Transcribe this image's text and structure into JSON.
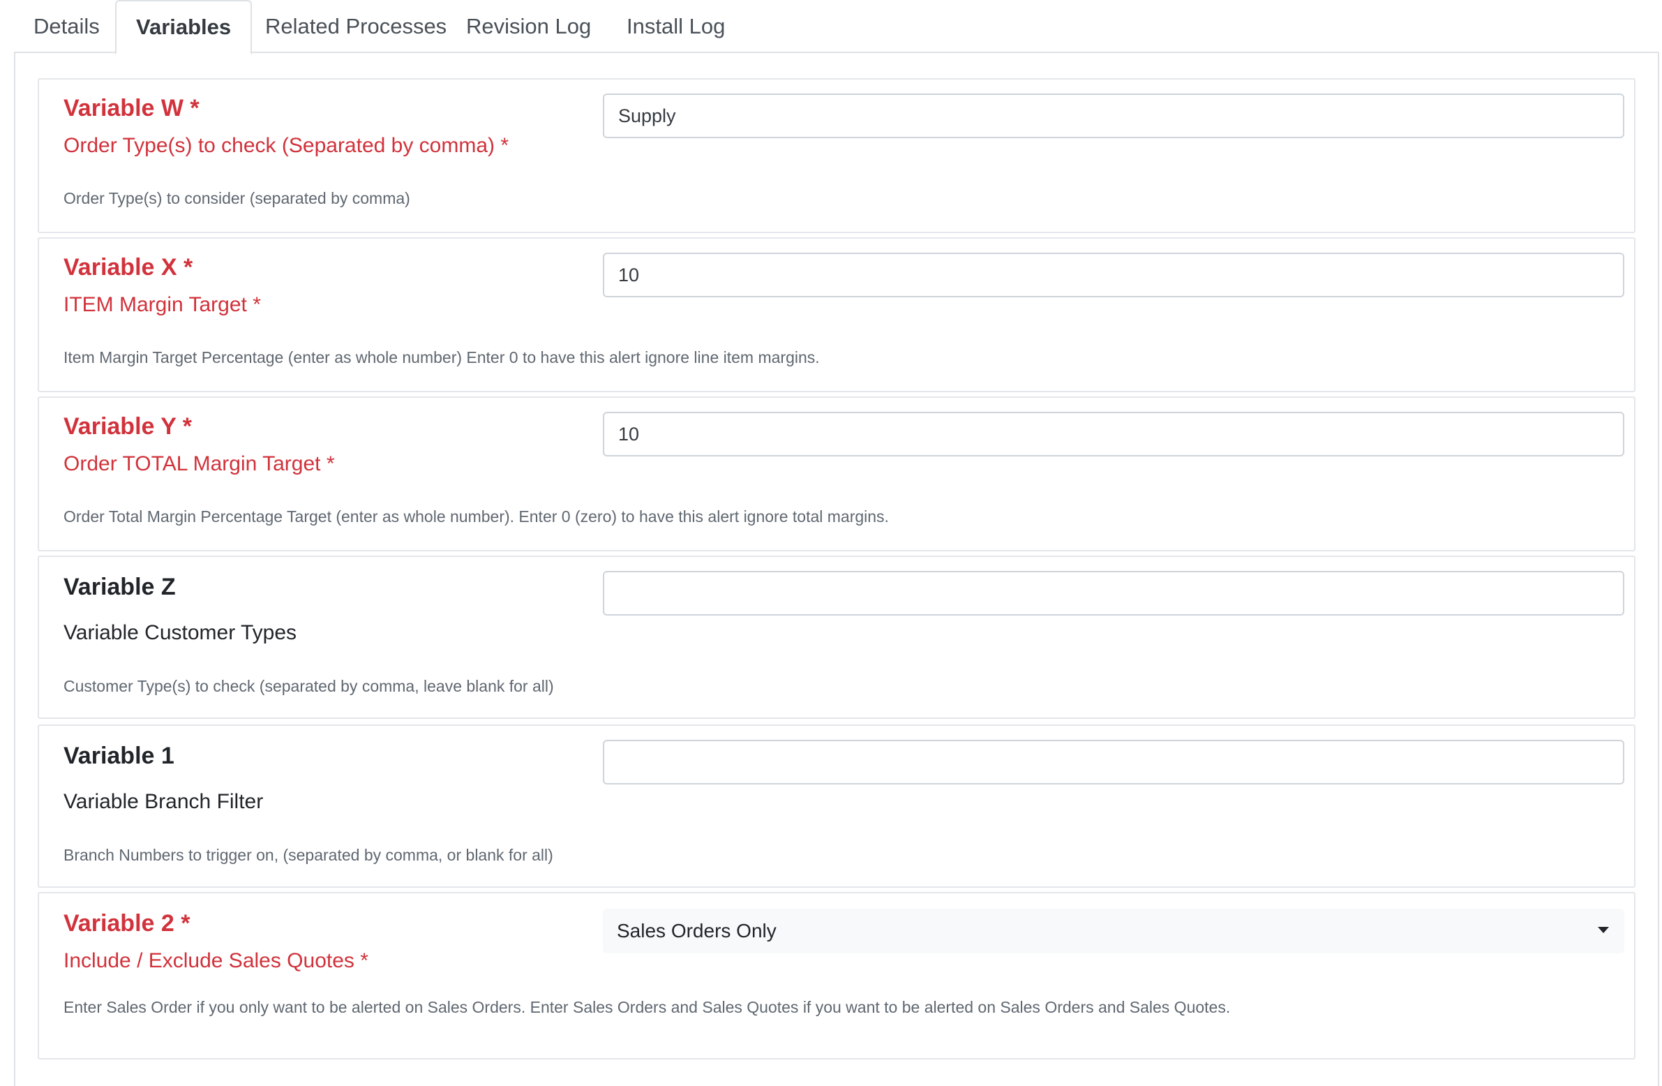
{
  "tabs": [
    {
      "label": "Details",
      "active": false
    },
    {
      "label": "Variables",
      "active": true
    },
    {
      "label": "Related Processes",
      "active": false
    },
    {
      "label": "Revision Log",
      "active": false
    },
    {
      "label": "Install Log",
      "active": false
    }
  ],
  "variables": [
    {
      "title": "Variable W *",
      "label": "Order Type(s) to check (Separated by comma) *",
      "help": "Order Type(s) to consider (separated by comma)",
      "value": "Supply",
      "required": true
    },
    {
      "title": "Variable X *",
      "label": "ITEM Margin Target *",
      "help": "Item Margin Target Percentage (enter as whole number) Enter 0 to have this alert ignore line item margins.",
      "value": "10",
      "required": true
    },
    {
      "title": "Variable Y *",
      "label": "Order TOTAL Margin Target *",
      "help": "Order Total Margin Percentage Target (enter as whole number). Enter 0 (zero) to have this alert ignore total margins.",
      "value": "10",
      "required": true
    },
    {
      "title": "Variable Z",
      "label": "Variable Customer Types",
      "help": "Customer Type(s) to check (separated by comma, leave blank for all)",
      "value": "",
      "required": false
    },
    {
      "title": "Variable 1",
      "label": "Variable Branch Filter",
      "help": "Branch Numbers to trigger on, (separated by comma, or blank for all)",
      "value": "",
      "required": false
    },
    {
      "title": "Variable 2 *",
      "label": "Include / Exclude Sales Quotes *",
      "help": "Enter Sales Order if you only want to be alerted on Sales Orders. Enter Sales Orders and Sales Quotes if you want to be alerted on Sales Orders and Sales Quotes.",
      "value": "Sales Orders Only",
      "required": true,
      "control": "select"
    }
  ],
  "colors": {
    "required_text": "#d1323b",
    "border": "#dee2e6",
    "help_text": "#5f6770"
  }
}
